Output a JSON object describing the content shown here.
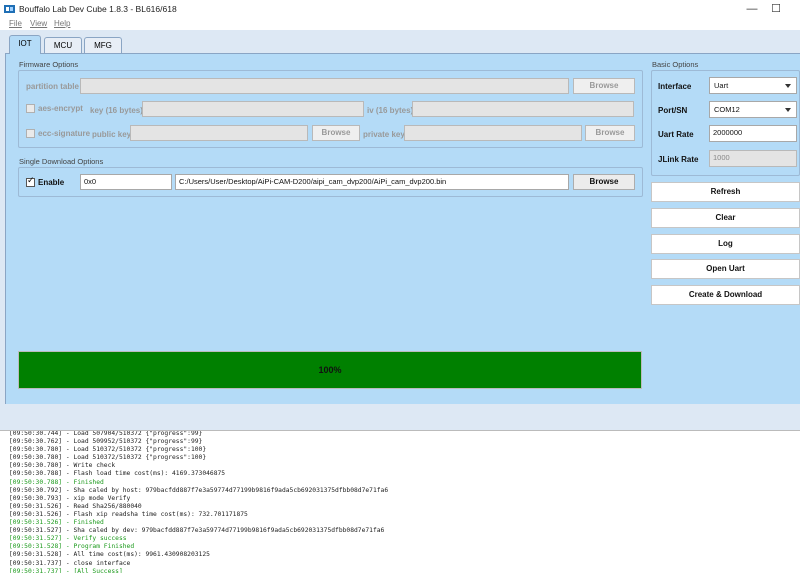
{
  "window": {
    "title": "Bouffalo Lab Dev Cube 1.8.3 - BL616/618",
    "minimize": "—",
    "maximize": "☐"
  },
  "menu": {
    "file": "File",
    "view": "View",
    "help": "Help"
  },
  "tabs": [
    "IOT",
    "MCU",
    "MFG"
  ],
  "firmware": {
    "section_title": "Firmware Options",
    "partition_label": "partition table",
    "partition_value": "",
    "browse_label": "Browse",
    "aes_label": "aes-encrypt",
    "key_label": "key (16 bytes)",
    "iv_label": "iv (16 bytes)",
    "ecc_label": "ecc-signature",
    "public_key_label": "public key",
    "private_key_label": "private key"
  },
  "single_download": {
    "section_title": "Single Download Options",
    "enable_label": "Enable",
    "address": "0x0",
    "path": "C:/Users/User/Desktop/AiPi-CAM-D200/aipi_cam_dvp200/AiPi_cam_dvp200.bin",
    "browse_label": "Browse"
  },
  "basic": {
    "section_title": "Basic Options",
    "interface_label": "Interface",
    "interface_value": "Uart",
    "port_label": "Port/SN",
    "port_value": "COM12",
    "uart_rate_label": "Uart Rate",
    "uart_rate_value": "2000000",
    "jlink_rate_label": "JLink Rate",
    "jlink_rate_value": "1000"
  },
  "actions": [
    "Refresh",
    "Clear",
    "Log",
    "Open Uart",
    "Create & Download"
  ],
  "progress": {
    "value": 1.0,
    "label": "100%",
    "color": "#008000"
  },
  "log": [
    {
      "text": "[09:50:30.744] - Load 507904/510372 {\"progress\":99}",
      "green": false
    },
    {
      "text": "[09:50:30.762] - Load 509952/510372 {\"progress\":99}",
      "green": false
    },
    {
      "text": "[09:50:30.780] - Load 510372/510372 {\"progress\":100}",
      "green": false
    },
    {
      "text": "[09:50:30.780] - Load 510372/510372 {\"progress\":100}",
      "green": false
    },
    {
      "text": "[09:50:30.780] - Write check",
      "green": false
    },
    {
      "text": "[09:50:30.788] - Flash load time cost(ms): 4169.373046875",
      "green": false
    },
    {
      "text": "[09:50:30.788] - Finished",
      "green": true
    },
    {
      "text": "[09:50:30.792] - Sha caled by host: 979bacfdd887f7e3a59774d77199b9816f9ada5cb692031375dfbb08d7e71fa6",
      "green": false
    },
    {
      "text": "[09:50:30.793] - xip mode Verify",
      "green": false
    },
    {
      "text": "[09:50:31.526] - Read Sha256/880040",
      "green": false
    },
    {
      "text": "[09:50:31.526] - Flash xip readsha time cost(ms): 732.701171875",
      "green": false
    },
    {
      "text": "[09:50:31.526] - Finished",
      "green": true
    },
    {
      "text": "[09:50:31.527] - Sha caled by dev: 979bacfdd887f7e3a59774d77199b9816f9ada5cb692031375dfbb08d7e71fa6",
      "green": false
    },
    {
      "text": "[09:50:31.527] - Verify success",
      "green": true
    },
    {
      "text": "[09:50:31.528] - Program Finished",
      "green": true
    },
    {
      "text": "[09:50:31.528] - All time cost(ms): 9961.430908203125",
      "green": false
    },
    {
      "text": "[09:50:31.737] - close interface",
      "green": false
    },
    {
      "text": "[09:50:31.737] - [All Success]",
      "green": true
    }
  ]
}
